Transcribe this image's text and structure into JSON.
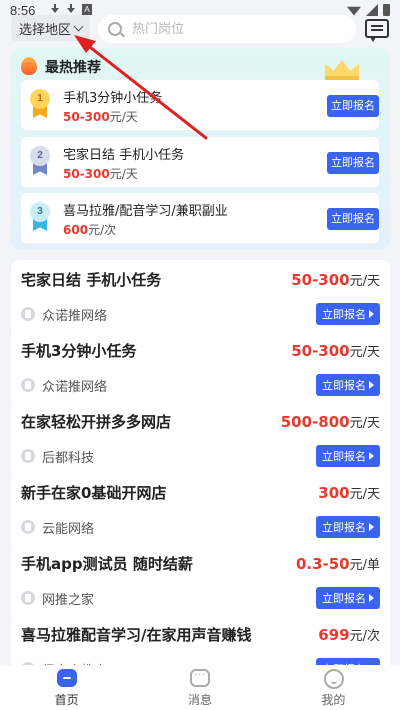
{
  "status_bar": {
    "time": "8:56",
    "a_icon": "A"
  },
  "header": {
    "region_label": "选择地区",
    "search_placeholder": "热门岗位"
  },
  "hot": {
    "title": "最热推荐",
    "items": [
      {
        "rank": "1",
        "title": "手机3分钟小任务",
        "salary": "50-300",
        "unit": "元/天",
        "apply": "立即报名"
      },
      {
        "rank": "2",
        "title": "宅家日结 手机小任务",
        "salary": "50-300",
        "unit": "元/天",
        "apply": "立即报名"
      },
      {
        "rank": "3",
        "title": "喜马拉雅/配音学习/兼职副业",
        "salary": "600",
        "unit": "元/次",
        "apply": "立即报名"
      }
    ]
  },
  "jobs": [
    {
      "title": "宅家日结 手机小任务",
      "salary": "50-300",
      "unit": "元/天",
      "company": "众诺推网络",
      "apply": "立即报名"
    },
    {
      "title": "手机3分钟小任务",
      "salary": "50-300",
      "unit": "元/天",
      "company": "众诺推网络",
      "apply": "立即报名"
    },
    {
      "title": "在家轻松开拼多多网店",
      "salary": "500-800",
      "unit": "元/天",
      "company": "后都科技",
      "apply": "立即报名"
    },
    {
      "title": "新手在家0基础开网店",
      "salary": "300",
      "unit": "元/天",
      "company": "云能网络",
      "apply": "立即报名"
    },
    {
      "title": "手机app测试员  随时结薪",
      "salary": "0.3-50",
      "unit": "元/单",
      "company": "网推之家",
      "apply": "立即报名"
    },
    {
      "title": "喜马拉雅配音学习/在家用声音赚钱",
      "salary": "699",
      "unit": "元/次",
      "company": "纽泰众教育",
      "apply": "立即报名"
    }
  ],
  "bottom_nav": [
    {
      "label": "首页",
      "icon": "home-icon",
      "active": true
    },
    {
      "label": "消息",
      "icon": "chat-icon",
      "active": false
    },
    {
      "label": "我的",
      "icon": "profile-icon",
      "active": false
    }
  ],
  "colors": {
    "accent": "#3a63f0",
    "salary": "#e8392e",
    "annotation_arrow": "#e02020"
  }
}
